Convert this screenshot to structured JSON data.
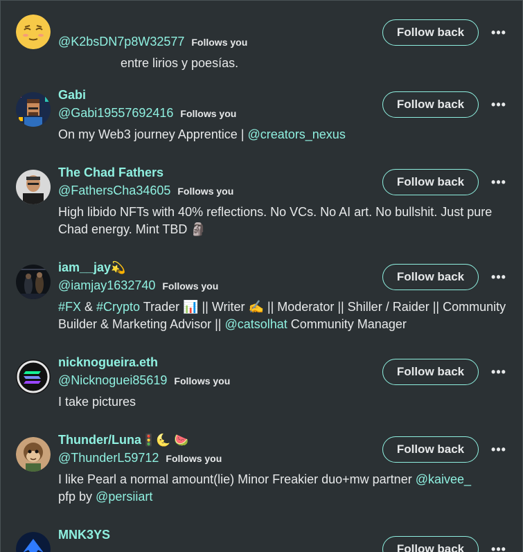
{
  "follow_label": "Follow back",
  "follows_you_label": "Follows you",
  "users": [
    {
      "name": "",
      "handle": "@K2bsDN7p8W32577",
      "bio": "entre lirios y poesías.",
      "avatar": "emoji-face"
    },
    {
      "name": "Gabi",
      "handle": "@Gabi19557692416",
      "bio_text": "On my Web3 journey Apprentice | ",
      "bio_link": "@creators_nexus",
      "avatar": "pixel-portrait"
    },
    {
      "name": "The Chad Fathers",
      "handle": "@FathersCha34605",
      "bio": "High libido NFTs with 40% reflections. No VCs. No AI art. No bullshit. Just pure Chad energy. Mint TBD 🗿",
      "avatar": "photo-man"
    },
    {
      "name": "iam__jay",
      "name_emoji": "💫",
      "handle": "@iamjay1632740",
      "bio_p1": "#FX",
      "bio_p2": " & ",
      "bio_p3": "#Crypto",
      "bio_p4": " Trader 📊 || Writer ✍️ || Moderator || Shiller / Raider || Community Builder & Marketing Advisor || ",
      "bio_p5": "@catsolhat",
      "bio_p6": " Community Manager",
      "avatar": "dark-scene"
    },
    {
      "name": "nicknogueira.eth",
      "handle": "@Nicknoguei85619",
      "bio": "I take pictures",
      "avatar": "solana-logo"
    },
    {
      "name": "Thunder/Luna",
      "name_emoji": "🚦🌜 🍉",
      "handle": "@ThunderL59712",
      "bio_text": "I like Pearl a normal amount(lie) Minor Freakier duo+mw partner ",
      "bio_link": "@kaivee_",
      "bio_line2_text": "pfp by ",
      "bio_line2_link": "@persiiart",
      "avatar": "monkey"
    },
    {
      "name": "MNK3YS",
      "avatar": "blue-logo"
    }
  ]
}
